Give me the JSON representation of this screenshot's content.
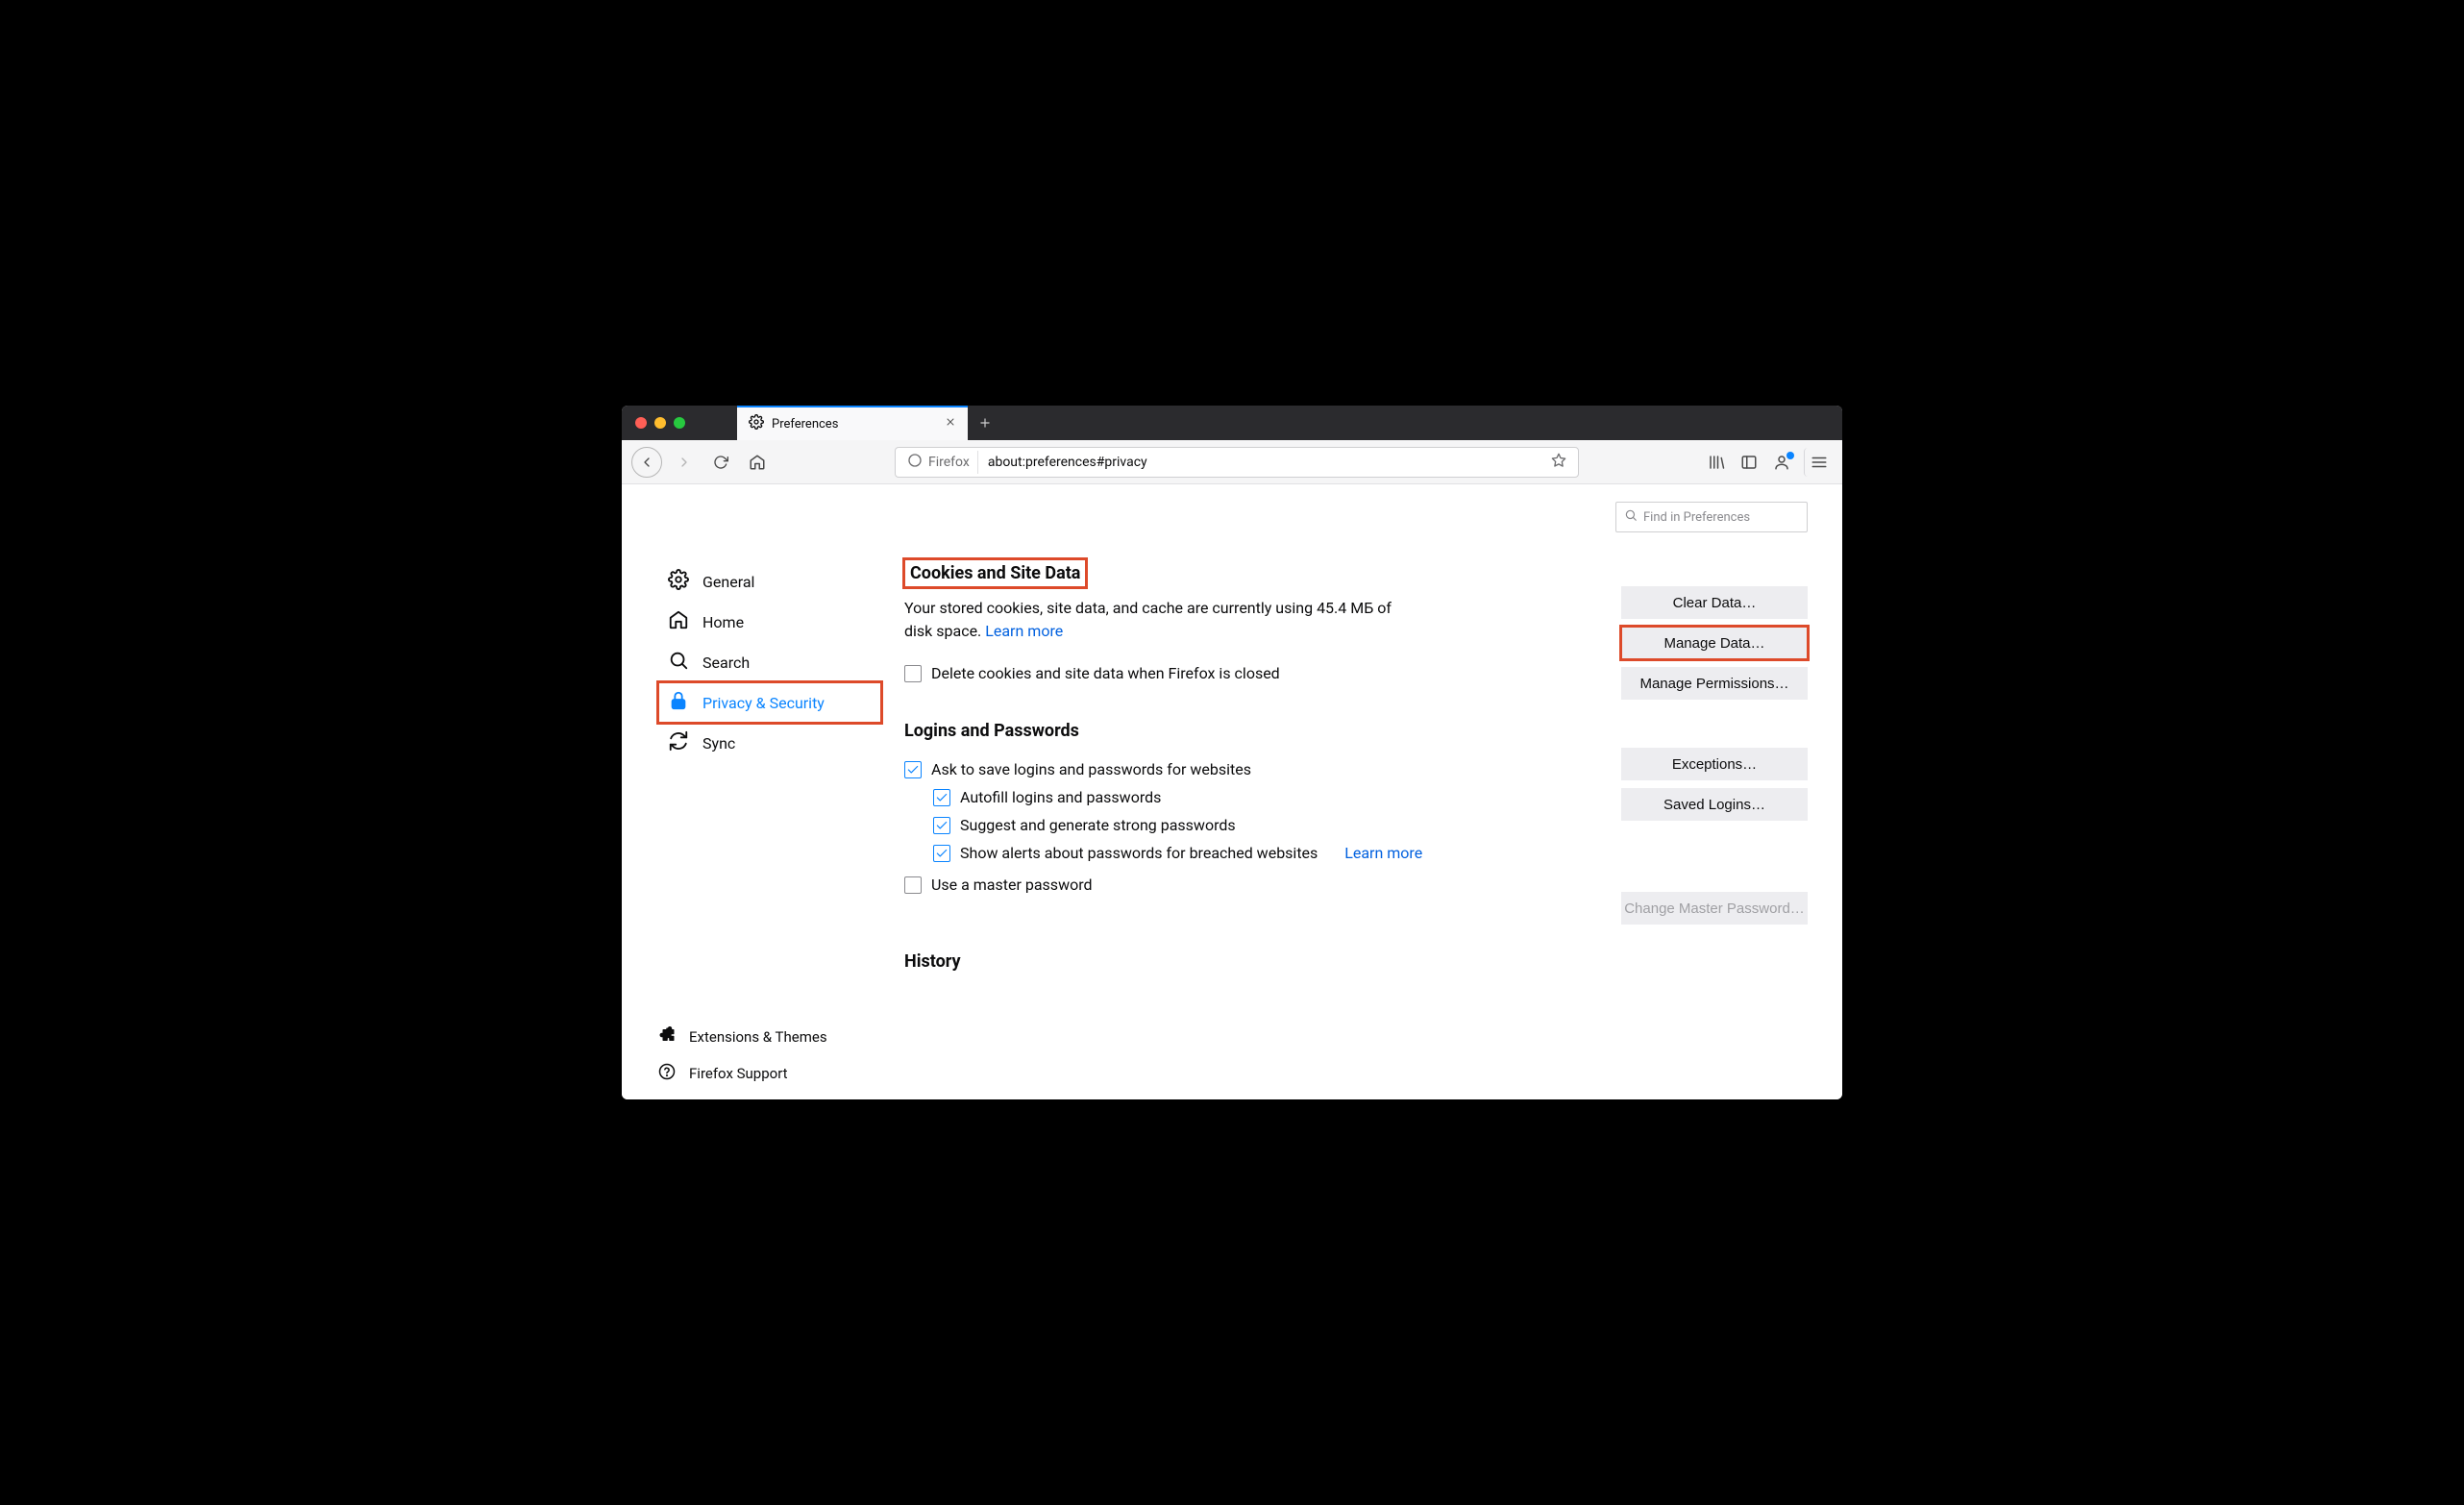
{
  "tab": {
    "title": "Preferences"
  },
  "urlbar": {
    "identity": "Firefox",
    "address": "about:preferences#privacy"
  },
  "find": {
    "placeholder": "Find in Preferences"
  },
  "sidebar": {
    "items": [
      {
        "label": "General"
      },
      {
        "label": "Home"
      },
      {
        "label": "Search"
      },
      {
        "label": "Privacy & Security"
      },
      {
        "label": "Sync"
      }
    ],
    "footer": [
      {
        "label": "Extensions & Themes"
      },
      {
        "label": "Firefox Support"
      }
    ]
  },
  "cookies": {
    "heading": "Cookies and Site Data",
    "desc_prefix": "Your stored cookies, site data, and cache are currently using 45.4 МБ of disk space.  ",
    "learn_more": "Learn more",
    "delete_on_close": "Delete cookies and site data when Firefox is closed",
    "buttons": {
      "clear": "Clear Data…",
      "manage": "Manage Data…",
      "perms": "Manage Permissions…"
    }
  },
  "logins": {
    "heading": "Logins and Passwords",
    "ask_save": "Ask to save logins and passwords for websites",
    "autofill": "Autofill logins and passwords",
    "suggest": "Suggest and generate strong passwords",
    "alerts": "Show alerts about passwords for breached websites",
    "learn_more": "Learn more",
    "master": "Use a master password",
    "buttons": {
      "exceptions": "Exceptions…",
      "saved": "Saved Logins…",
      "change_master": "Change Master Password…"
    }
  },
  "history": {
    "heading": "History"
  }
}
